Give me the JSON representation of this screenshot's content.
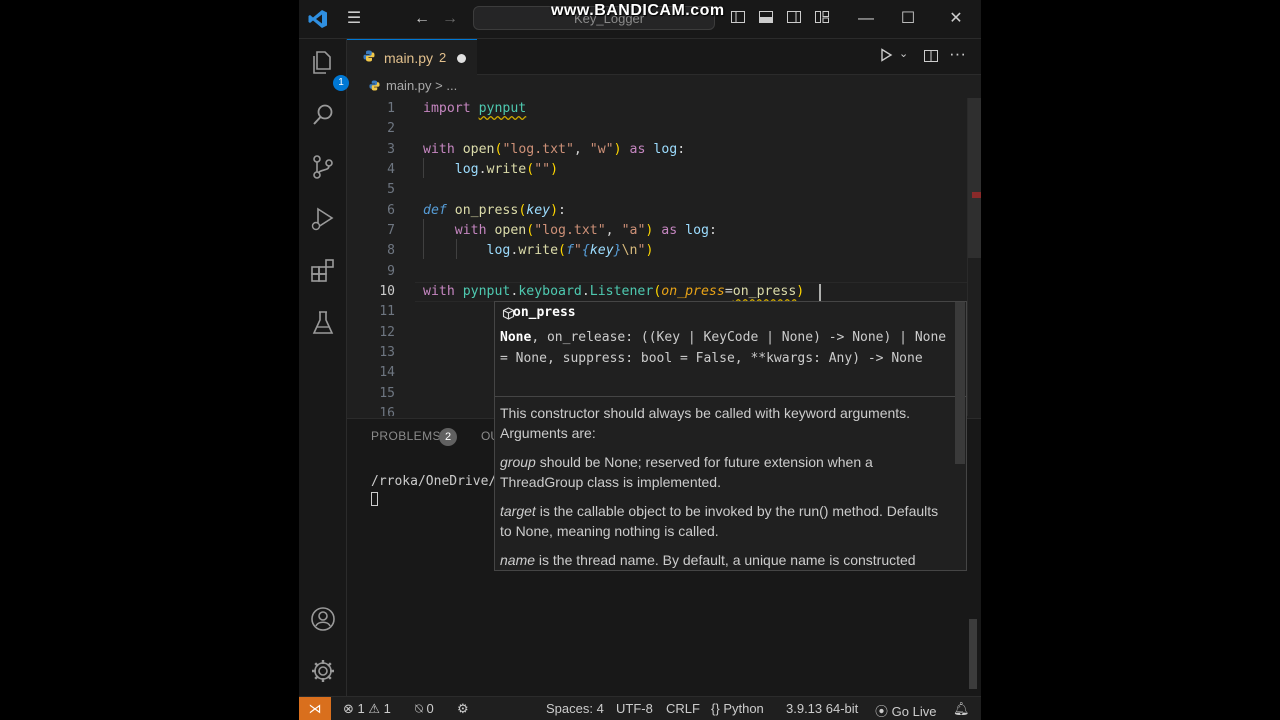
{
  "window": {
    "search_text": "Key_Logger",
    "overlay_watermark": "www.BANDICAM.com"
  },
  "activity_bar": {
    "explorer_badge": "1"
  },
  "tab": {
    "filename": "main.py",
    "problem_count": "2"
  },
  "breadcrumb": {
    "file": "main.py",
    "separator": ">",
    "more": "..."
  },
  "editor": {
    "line_numbers": [
      "1",
      "2",
      "3",
      "4",
      "5",
      "6",
      "7",
      "8",
      "9",
      "10",
      "11",
      "12",
      "13",
      "14",
      "15",
      "16"
    ],
    "active_line": "10"
  },
  "hover": {
    "title": "on_press",
    "signature_bold": "None",
    "signature_rest": ", on_release: ((Key | KeyCode | None) -> None) | None = None, suppress: bool = False, **kwargs: Any) -> None",
    "doc_intro": "This constructor should always be called with keyword arguments. Arguments are:",
    "doc_group_term": "group",
    "doc_group": " should be None; reserved for future extension when a ThreadGroup class is implemented.",
    "doc_target_term": "target",
    "doc_target": " is the callable object to be invoked by the run() method. Defaults to None, meaning nothing is called.",
    "doc_name_term": "name",
    "doc_name": " is the thread name. By default, a unique name is constructed"
  },
  "panel": {
    "problems_label": "PROBLEMS",
    "problems_count": "2",
    "next_tab_partial": "OU",
    "terminal_line": "/rroka/OneDrive/"
  },
  "statusbar": {
    "errors": "1",
    "warnings": "1",
    "ports": "0",
    "spaces": "Spaces: 4",
    "encoding": "UTF-8",
    "eol": "CRLF",
    "language": "Python",
    "interpreter": "3.9.13 64-bit",
    "go_live": "Go Live"
  },
  "colors": {
    "accent": "#0078d4",
    "remote": "#d96f1d",
    "modified_tab": "#e2c08d",
    "keyword": "#c586c0",
    "function": "#dcdcaa",
    "string": "#ce9178"
  }
}
